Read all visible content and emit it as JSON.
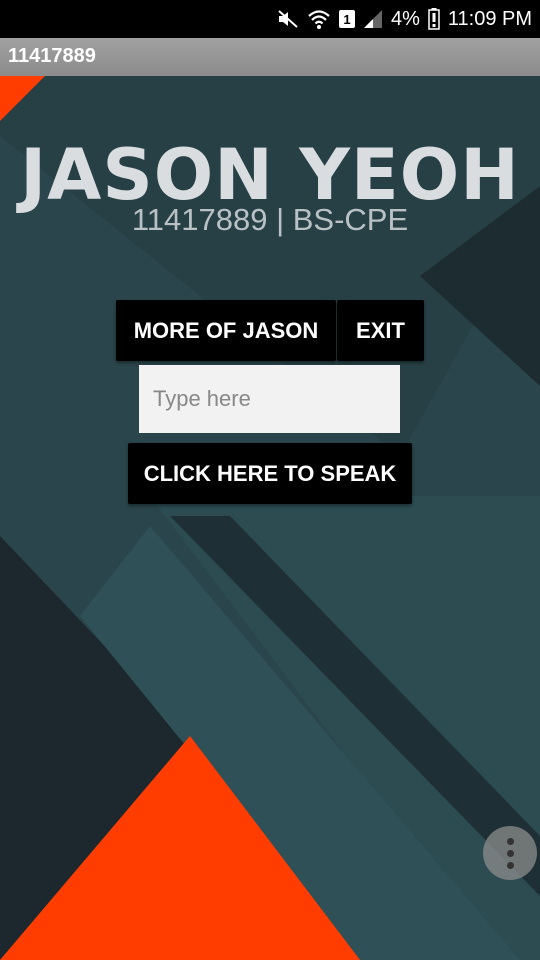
{
  "status_bar": {
    "battery": "4%",
    "time": "11:09 PM",
    "sim_slot": "1"
  },
  "app": {
    "title": "11417889"
  },
  "profile": {
    "name": "JASON YEOH",
    "subtitle": "11417889 | BS-CPE"
  },
  "buttons": {
    "more": "MORE OF JASON",
    "exit": "EXIT",
    "speak": "CLICK HERE TO SPEAK"
  },
  "input": {
    "placeholder": "Type here",
    "value": ""
  },
  "icons": [
    "mute-icon",
    "wifi-icon",
    "sim-icon",
    "signal-icon",
    "battery-icon",
    "overflow-menu-icon"
  ],
  "colors": {
    "accent": "#ff3d00",
    "background": "#2a454b",
    "button": "#000000"
  }
}
